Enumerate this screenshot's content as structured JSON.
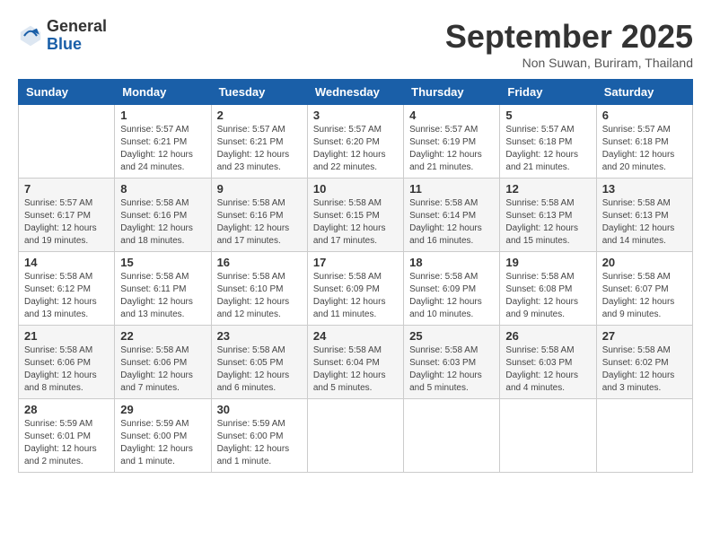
{
  "header": {
    "logo_general": "General",
    "logo_blue": "Blue",
    "month_title": "September 2025",
    "subtitle": "Non Suwan, Buriram, Thailand"
  },
  "days_of_week": [
    "Sunday",
    "Monday",
    "Tuesday",
    "Wednesday",
    "Thursday",
    "Friday",
    "Saturday"
  ],
  "weeks": [
    [
      {
        "day": "",
        "info": ""
      },
      {
        "day": "1",
        "info": "Sunrise: 5:57 AM\nSunset: 6:21 PM\nDaylight: 12 hours\nand 24 minutes."
      },
      {
        "day": "2",
        "info": "Sunrise: 5:57 AM\nSunset: 6:21 PM\nDaylight: 12 hours\nand 23 minutes."
      },
      {
        "day": "3",
        "info": "Sunrise: 5:57 AM\nSunset: 6:20 PM\nDaylight: 12 hours\nand 22 minutes."
      },
      {
        "day": "4",
        "info": "Sunrise: 5:57 AM\nSunset: 6:19 PM\nDaylight: 12 hours\nand 21 minutes."
      },
      {
        "day": "5",
        "info": "Sunrise: 5:57 AM\nSunset: 6:18 PM\nDaylight: 12 hours\nand 21 minutes."
      },
      {
        "day": "6",
        "info": "Sunrise: 5:57 AM\nSunset: 6:18 PM\nDaylight: 12 hours\nand 20 minutes."
      }
    ],
    [
      {
        "day": "7",
        "info": "Sunrise: 5:57 AM\nSunset: 6:17 PM\nDaylight: 12 hours\nand 19 minutes."
      },
      {
        "day": "8",
        "info": "Sunrise: 5:58 AM\nSunset: 6:16 PM\nDaylight: 12 hours\nand 18 minutes."
      },
      {
        "day": "9",
        "info": "Sunrise: 5:58 AM\nSunset: 6:16 PM\nDaylight: 12 hours\nand 17 minutes."
      },
      {
        "day": "10",
        "info": "Sunrise: 5:58 AM\nSunset: 6:15 PM\nDaylight: 12 hours\nand 17 minutes."
      },
      {
        "day": "11",
        "info": "Sunrise: 5:58 AM\nSunset: 6:14 PM\nDaylight: 12 hours\nand 16 minutes."
      },
      {
        "day": "12",
        "info": "Sunrise: 5:58 AM\nSunset: 6:13 PM\nDaylight: 12 hours\nand 15 minutes."
      },
      {
        "day": "13",
        "info": "Sunrise: 5:58 AM\nSunset: 6:13 PM\nDaylight: 12 hours\nand 14 minutes."
      }
    ],
    [
      {
        "day": "14",
        "info": "Sunrise: 5:58 AM\nSunset: 6:12 PM\nDaylight: 12 hours\nand 13 minutes."
      },
      {
        "day": "15",
        "info": "Sunrise: 5:58 AM\nSunset: 6:11 PM\nDaylight: 12 hours\nand 13 minutes."
      },
      {
        "day": "16",
        "info": "Sunrise: 5:58 AM\nSunset: 6:10 PM\nDaylight: 12 hours\nand 12 minutes."
      },
      {
        "day": "17",
        "info": "Sunrise: 5:58 AM\nSunset: 6:09 PM\nDaylight: 12 hours\nand 11 minutes."
      },
      {
        "day": "18",
        "info": "Sunrise: 5:58 AM\nSunset: 6:09 PM\nDaylight: 12 hours\nand 10 minutes."
      },
      {
        "day": "19",
        "info": "Sunrise: 5:58 AM\nSunset: 6:08 PM\nDaylight: 12 hours\nand 9 minutes."
      },
      {
        "day": "20",
        "info": "Sunrise: 5:58 AM\nSunset: 6:07 PM\nDaylight: 12 hours\nand 9 minutes."
      }
    ],
    [
      {
        "day": "21",
        "info": "Sunrise: 5:58 AM\nSunset: 6:06 PM\nDaylight: 12 hours\nand 8 minutes."
      },
      {
        "day": "22",
        "info": "Sunrise: 5:58 AM\nSunset: 6:06 PM\nDaylight: 12 hours\nand 7 minutes."
      },
      {
        "day": "23",
        "info": "Sunrise: 5:58 AM\nSunset: 6:05 PM\nDaylight: 12 hours\nand 6 minutes."
      },
      {
        "day": "24",
        "info": "Sunrise: 5:58 AM\nSunset: 6:04 PM\nDaylight: 12 hours\nand 5 minutes."
      },
      {
        "day": "25",
        "info": "Sunrise: 5:58 AM\nSunset: 6:03 PM\nDaylight: 12 hours\nand 5 minutes."
      },
      {
        "day": "26",
        "info": "Sunrise: 5:58 AM\nSunset: 6:03 PM\nDaylight: 12 hours\nand 4 minutes."
      },
      {
        "day": "27",
        "info": "Sunrise: 5:58 AM\nSunset: 6:02 PM\nDaylight: 12 hours\nand 3 minutes."
      }
    ],
    [
      {
        "day": "28",
        "info": "Sunrise: 5:59 AM\nSunset: 6:01 PM\nDaylight: 12 hours\nand 2 minutes."
      },
      {
        "day": "29",
        "info": "Sunrise: 5:59 AM\nSunset: 6:00 PM\nDaylight: 12 hours\nand 1 minute."
      },
      {
        "day": "30",
        "info": "Sunrise: 5:59 AM\nSunset: 6:00 PM\nDaylight: 12 hours\nand 1 minute."
      },
      {
        "day": "",
        "info": ""
      },
      {
        "day": "",
        "info": ""
      },
      {
        "day": "",
        "info": ""
      },
      {
        "day": "",
        "info": ""
      }
    ]
  ]
}
